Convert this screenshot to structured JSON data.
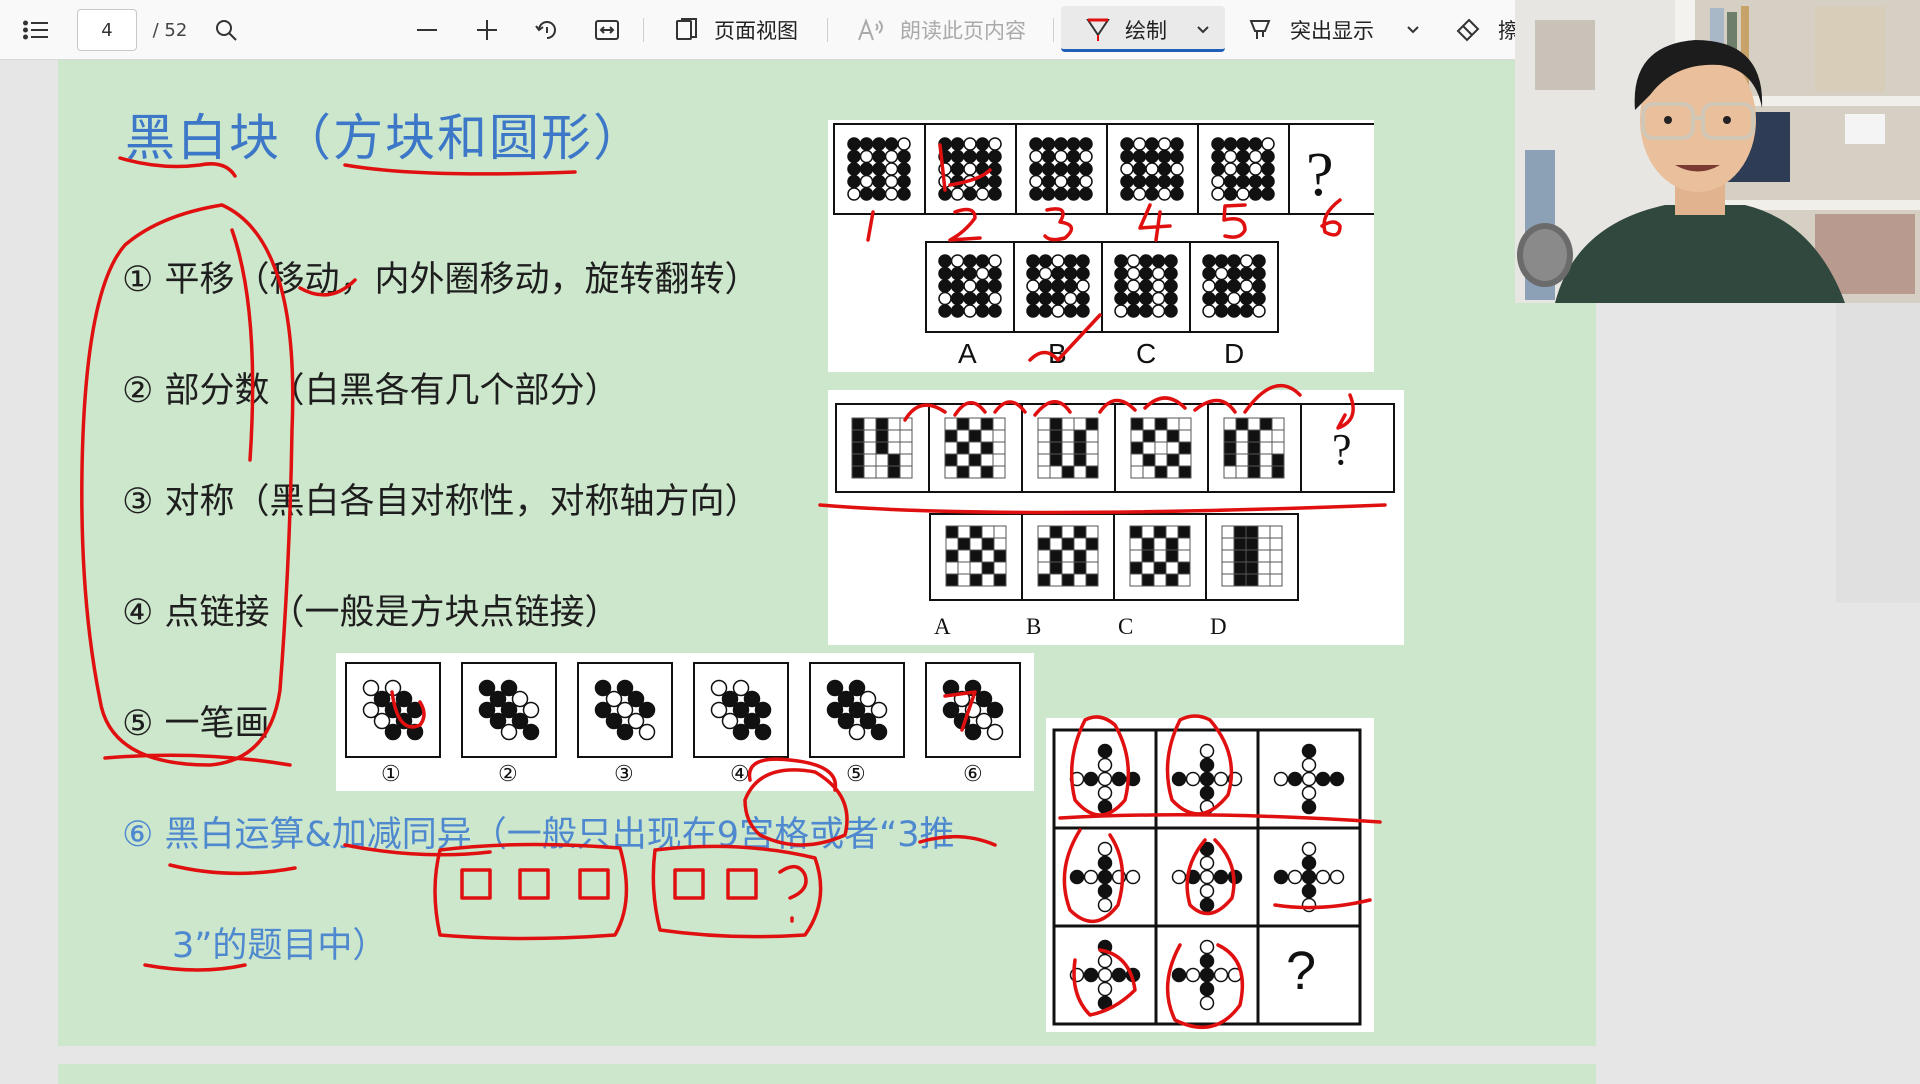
{
  "toolbar": {
    "page_current": "4",
    "page_total": "/ 52",
    "page_view_label": "页面视图",
    "read_aloud_label": "朗读此页内容",
    "draw_label": "绘制",
    "highlight_label": "突出显示",
    "erase_label": "擦",
    "icons": [
      "list-icon",
      "search-icon",
      "minus-icon",
      "plus-icon",
      "rotate-icon",
      "fit-width-icon",
      "page-view-icon",
      "read-aloud-icon",
      "pen-icon",
      "chevron-down-icon",
      "highlighter-icon",
      "eraser-icon"
    ]
  },
  "document": {
    "title": "黑白块（方块和圆形）",
    "items": [
      {
        "text": "① 平移（移动，内外圈移动，旋转翻转）"
      },
      {
        "text": "② 部分数（白黑各有几个部分）"
      },
      {
        "text": "③ 对称（黑白各自对称性，对称轴方向）"
      },
      {
        "text": "④ 点链接（一般是方块点链接）"
      },
      {
        "text": "⑤ 一笔画"
      },
      {
        "text": "⑥ 黑白运算&加减同异（一般只出现在9宫格或者“3推"
      },
      {
        "text": "3”的题目中）"
      }
    ],
    "puzzle1": {
      "options": [
        "A",
        "B",
        "C",
        "D"
      ],
      "question": "?"
    },
    "puzzle2": {
      "options": [
        "A",
        "B",
        "C",
        "D"
      ],
      "question": "?"
    },
    "puzzle3": {
      "labels": [
        "①",
        "②",
        "③",
        "④",
        "⑤",
        "⑥"
      ]
    },
    "puzzle4": {
      "question": "?"
    },
    "annotations": {
      "numbers": [
        "1",
        "2",
        "3",
        "4",
        "5",
        "6"
      ]
    }
  },
  "colors": {
    "page_bg": "#cde7cc",
    "title_blue": "#3d78c8",
    "ink_red": "#e01010",
    "toolbar_accent": "#1f5fb8"
  }
}
